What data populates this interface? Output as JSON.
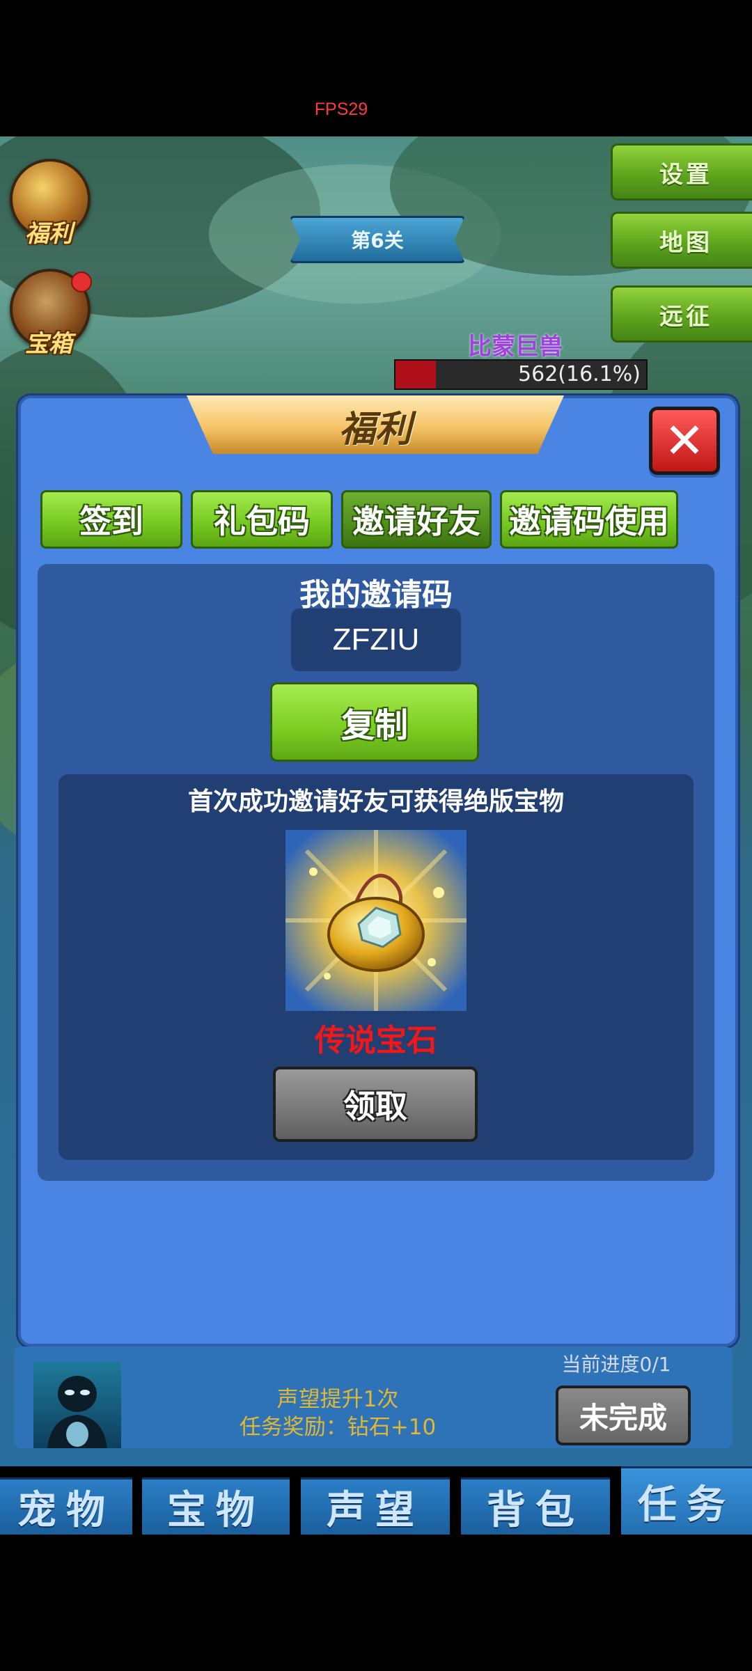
{
  "status": {
    "fps": "FPS29"
  },
  "scene": {
    "left_icons": [
      {
        "label": "福利",
        "icon": "gift-bag-icon"
      },
      {
        "label": "宝箱",
        "icon": "treasure-chest-icon"
      }
    ],
    "right_buttons": [
      "设置",
      "地图",
      "远征"
    ],
    "level": "第6关",
    "boss": {
      "name": "比蒙巨兽",
      "hp_text": "562(16.1%)",
      "hp_percent": 16.1
    }
  },
  "dialog": {
    "title": "福利",
    "close_icon": "close-x-icon",
    "tabs": [
      {
        "label": "签到",
        "active": false
      },
      {
        "label": "礼包码",
        "active": false
      },
      {
        "label": "邀请好友",
        "active": true
      },
      {
        "label": "邀请码使用",
        "active": false
      }
    ],
    "invite": {
      "heading": "我的邀请码",
      "code": "ZFZIU",
      "copy_label": "复制"
    },
    "reward": {
      "description": "首次成功邀请好友可获得绝版宝物",
      "item_name": "传说宝石",
      "item_icon": "gem-amulet-icon",
      "claim_label": "领取"
    }
  },
  "task": {
    "title": "声望提升1次",
    "reward": "任务奖励：钻石+10",
    "progress": "当前进度0/1",
    "status_label": "未完成"
  },
  "bottom_tabs": [
    {
      "label": "宠物",
      "active": false
    },
    {
      "label": "宝物",
      "active": false
    },
    {
      "label": "声望",
      "active": false
    },
    {
      "label": "背包",
      "active": false
    },
    {
      "label": "任务",
      "active": true
    }
  ]
}
